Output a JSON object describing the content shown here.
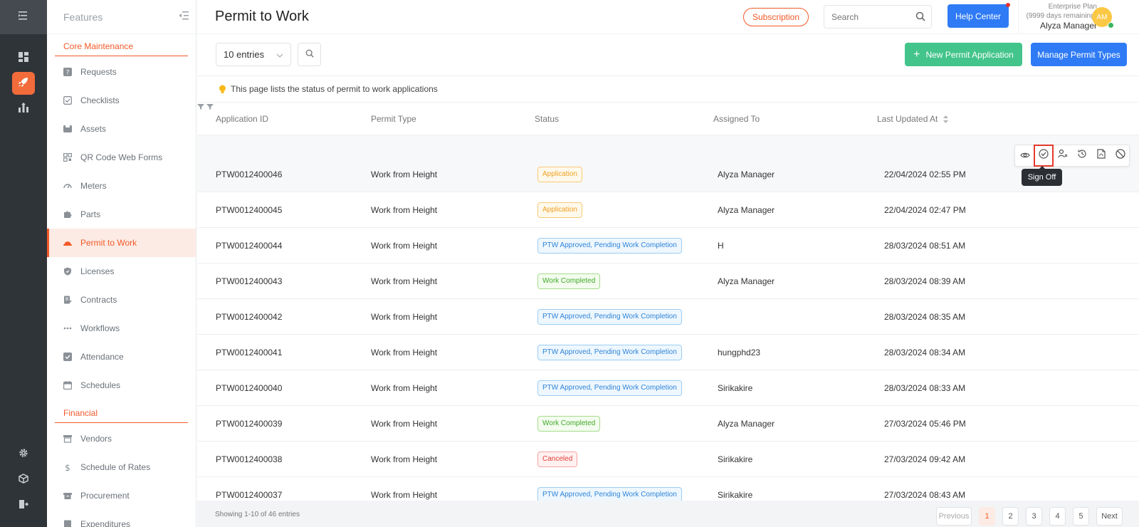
{
  "sidebar": {
    "title": "Features",
    "sections": [
      {
        "label": "Core Maintenance"
      },
      {
        "label": "Financial"
      }
    ],
    "core_items": [
      {
        "label": "Requests",
        "icon": "question-square-icon"
      },
      {
        "label": "Checklists",
        "icon": "checklist-icon"
      },
      {
        "label": "Assets",
        "icon": "asset-box-icon"
      },
      {
        "label": "QR Code Web Forms",
        "icon": "qr-code-icon"
      },
      {
        "label": "Meters",
        "icon": "gauge-icon"
      },
      {
        "label": "Parts",
        "icon": "puzzle-icon"
      },
      {
        "label": "Permit to Work",
        "icon": "hard-hat-icon",
        "active": true
      },
      {
        "label": "Licenses",
        "icon": "shield-icon"
      },
      {
        "label": "Contracts",
        "icon": "contract-icon"
      },
      {
        "label": "Workflows",
        "icon": "dots-icon"
      },
      {
        "label": "Attendance",
        "icon": "attendance-check-icon"
      },
      {
        "label": "Schedules",
        "icon": "calendar-icon"
      }
    ],
    "financial_items": [
      {
        "label": "Vendors",
        "icon": "store-icon"
      },
      {
        "label": "Schedule of Rates",
        "icon": "dollar-icon"
      },
      {
        "label": "Procurement",
        "icon": "procurement-icon"
      },
      {
        "label": "Expenditures",
        "icon": "expenditure-icon"
      }
    ]
  },
  "header": {
    "title": "Permit to Work",
    "subscription_label": "Subscription",
    "search_placeholder": "Search",
    "help_label": "Help Center",
    "plan_name": "Enterprise Plan",
    "plan_remaining": "(9999 days remaining)",
    "user_name": "Alyza Manager",
    "avatar_initials": "AM"
  },
  "toolbar": {
    "entries_label": "10 entries",
    "new_label": "New Permit Application",
    "new_plus": "+",
    "manage_label": "Manage Permit Types"
  },
  "info_text": "This page lists the status of permit to work applications",
  "table": {
    "columns": [
      "Application ID",
      "Permit Type",
      "Status",
      "Assigned To",
      "Last Updated At"
    ],
    "rows": [
      {
        "id": "PTW0012400046",
        "type": "Work from Height",
        "status": "Application",
        "kind": "app",
        "assigned": "Alyza Manager",
        "updated": "22/04/2024 02:55 PM"
      },
      {
        "id": "PTW0012400045",
        "type": "Work from Height",
        "status": "Application",
        "kind": "app",
        "assigned": "Alyza Manager",
        "updated": "22/04/2024 02:47 PM"
      },
      {
        "id": "PTW0012400044",
        "type": "Work from Height",
        "status": "PTW Approved, Pending Work Completion",
        "kind": "ptw",
        "assigned": "H",
        "updated": "28/03/2024 08:51 AM"
      },
      {
        "id": "PTW0012400043",
        "type": "Work from Height",
        "status": "Work Completed",
        "kind": "done",
        "assigned": "Alyza Manager",
        "updated": "28/03/2024 08:39 AM"
      },
      {
        "id": "PTW0012400042",
        "type": "Work from Height",
        "status": "PTW Approved, Pending Work Completion",
        "kind": "ptw",
        "assigned": "",
        "updated": "28/03/2024 08:35 AM"
      },
      {
        "id": "PTW0012400041",
        "type": "Work from Height",
        "status": "PTW Approved, Pending Work Completion",
        "kind": "ptw",
        "assigned": "hungphd23",
        "updated": "28/03/2024 08:34 AM"
      },
      {
        "id": "PTW0012400040",
        "type": "Work from Height",
        "status": "PTW Approved, Pending Work Completion",
        "kind": "ptw",
        "assigned": "Sirikakire",
        "updated": "28/03/2024 08:33 AM"
      },
      {
        "id": "PTW0012400039",
        "type": "Work from Height",
        "status": "Work Completed",
        "kind": "done",
        "assigned": "Alyza Manager",
        "updated": "27/03/2024 05:46 PM"
      },
      {
        "id": "PTW0012400038",
        "type": "Work from Height",
        "status": "Canceled",
        "kind": "cancel",
        "assigned": "Sirikakire",
        "updated": "27/03/2024 09:42 AM"
      },
      {
        "id": "PTW0012400037",
        "type": "Work from Height",
        "status": "PTW Approved, Pending Work Completion",
        "kind": "ptw",
        "assigned": "Sirikakire",
        "updated": "27/03/2024 08:43 AM"
      }
    ]
  },
  "row_actions": {
    "tooltip": "Sign Off",
    "icons": [
      "eye-icon",
      "sign-off-check-icon",
      "assign-user-icon",
      "history-icon",
      "pdf-file-icon",
      "cancel-icon"
    ]
  },
  "footer": {
    "showing": "Showing 1-10 of 46 entries",
    "previous": "Previous",
    "pages": [
      "1",
      "2",
      "3",
      "4",
      "5"
    ],
    "next": "Next"
  },
  "colors": {
    "accent": "#f25a29",
    "primary": "#2f7bf5",
    "success": "#43c48b"
  }
}
